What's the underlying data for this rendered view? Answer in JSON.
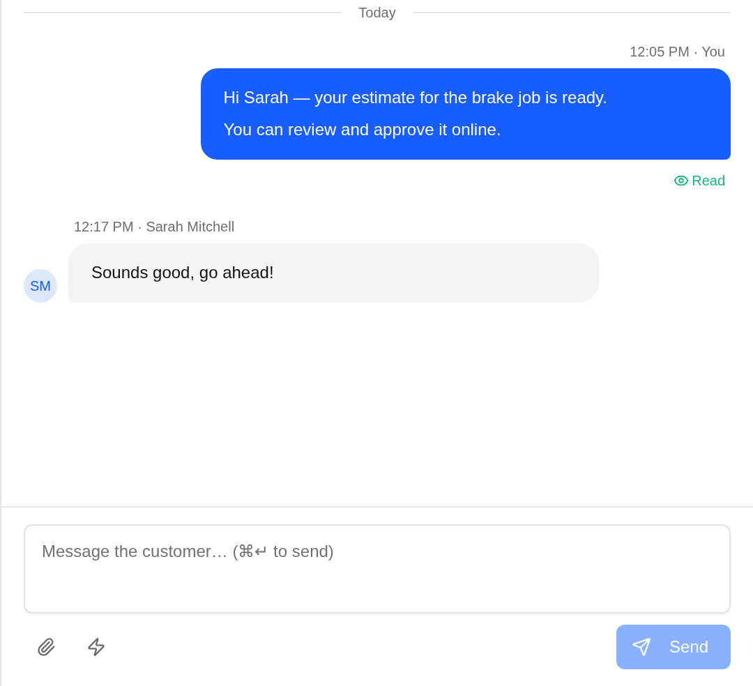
{
  "date_divider": {
    "label": "Today"
  },
  "messages": [
    {
      "kind": "outgoing",
      "meta": "12:05 PM · You",
      "text": "Hi Sarah — your estimate for the brake job is ready.\nYou can review and approve it online.",
      "receipt": "Read"
    },
    {
      "kind": "incoming",
      "meta": "12:17 PM · Sarah Mitchell",
      "avatar": "SM",
      "text": "Sounds good, go ahead!"
    }
  ],
  "composer": {
    "placeholder": "Message the customer… (⌘↵ to send)",
    "send": {
      "label": "Send",
      "disabled": true
    }
  }
}
